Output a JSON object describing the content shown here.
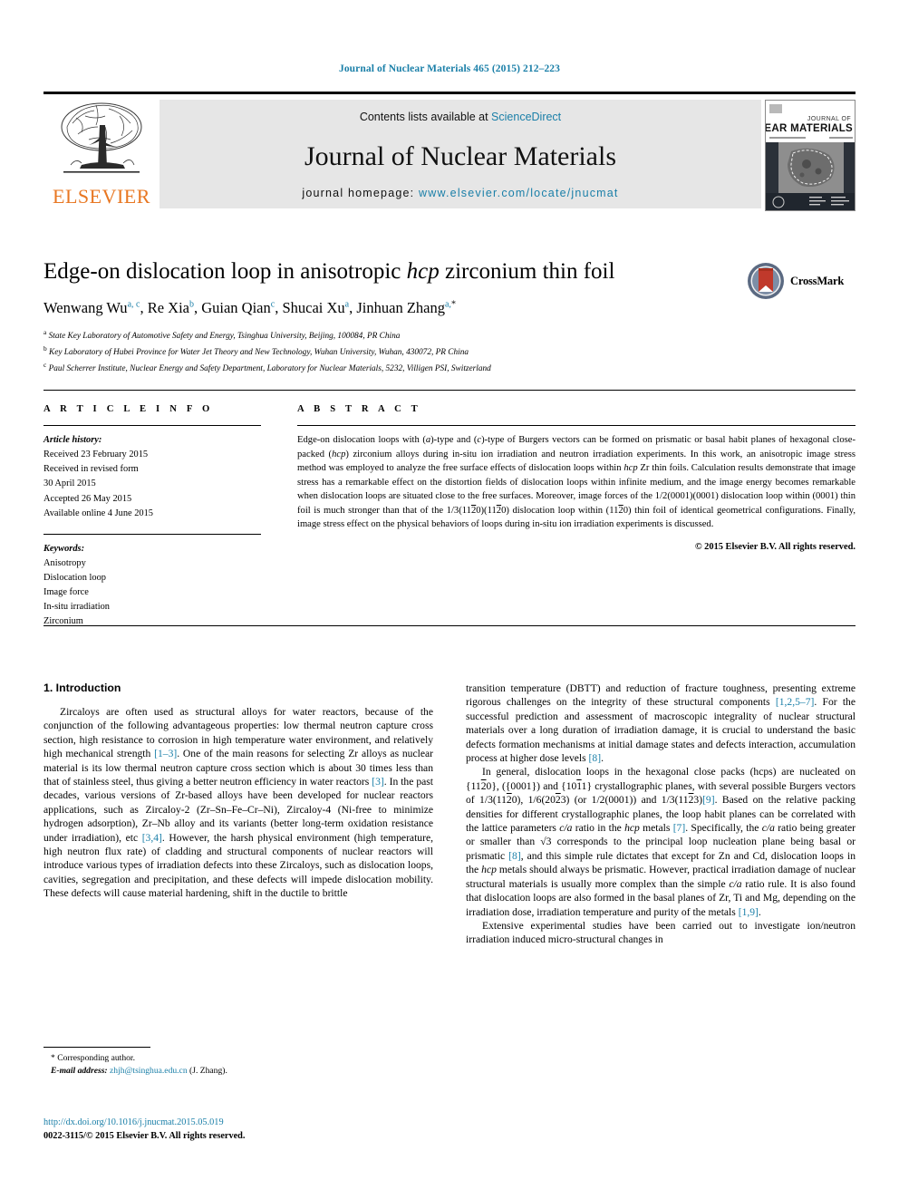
{
  "running_head": "Journal of Nuclear Materials 465 (2015) 212–223",
  "masthead": {
    "publisher_name": "ELSEVIER",
    "contents_prefix": "Contents lists available at ",
    "contents_link": "ScienceDirect",
    "journal_title": "Journal of Nuclear Materials",
    "homepage_prefix": "journal homepage: ",
    "homepage_url": "www.elsevier.com/locate/jnucmat",
    "cover_line1": "JOURNAL OF",
    "cover_line2": "NUCLEAR MATERIALS"
  },
  "article": {
    "title_part1": "Edge-on dislocation loop in anisotropic ",
    "title_italic": "hcp",
    "title_part2": " zirconium thin foil",
    "crossmark_label": "CrossMark",
    "authors_text": "Wenwang Wu a, c, Re Xia b, Guian Qian c, Shucai Xu a, Jinhuan Zhang a, *",
    "authors": [
      {
        "name": "Wenwang Wu",
        "marks": "a, c"
      },
      {
        "name": "Re Xia",
        "marks": "b"
      },
      {
        "name": "Guian Qian",
        "marks": "c"
      },
      {
        "name": "Shucai Xu",
        "marks": "a"
      },
      {
        "name": "Jinhuan Zhang",
        "marks": "a, *"
      }
    ],
    "affiliations": [
      {
        "mark": "a",
        "text": "State Key Laboratory of Automotive Safety and Energy, Tsinghua University, Beijing, 100084, PR China"
      },
      {
        "mark": "b",
        "text": "Key Laboratory of Hubei Province for Water Jet Theory and New Technology, Wuhan University, Wuhan, 430072, PR China"
      },
      {
        "mark": "c",
        "text": "Paul Scherrer Institute, Nuclear Energy and Safety Department, Laboratory for Nuclear Materials, 5232, Villigen PSI, Switzerland"
      }
    ]
  },
  "article_info": {
    "heading": "A R T I C L E   I N F O",
    "history_label": "Article history:",
    "history": [
      "Received 23 February 2015",
      "Received in revised form",
      "30 April 2015",
      "Accepted 26 May 2015",
      "Available online 4 June 2015"
    ],
    "keywords_label": "Keywords:",
    "keywords": [
      "Anisotropy",
      "Dislocation loop",
      "Image force",
      "In-situ irradiation",
      "Zirconium"
    ]
  },
  "abstract": {
    "heading": "A B S T R A C T",
    "copyright": "© 2015 Elsevier B.V. All rights reserved."
  },
  "sections": {
    "introduction_title": "1. Introduction"
  },
  "footnote": {
    "corresponding": "* Corresponding author.",
    "email_label": "E-mail address:",
    "email": "zhjh@tsinghua.edu.cn",
    "email_owner": "(J. Zhang)."
  },
  "footer": {
    "doi": "http://dx.doi.org/10.1016/j.jnucmat.2015.05.019",
    "issn_line": "0022-3115/© 2015 Elsevier B.V. All rights reserved."
  },
  "colors": {
    "link": "#1a7fa8",
    "elsevier_orange": "#e87722",
    "panel_gray": "#e6e6e6"
  }
}
